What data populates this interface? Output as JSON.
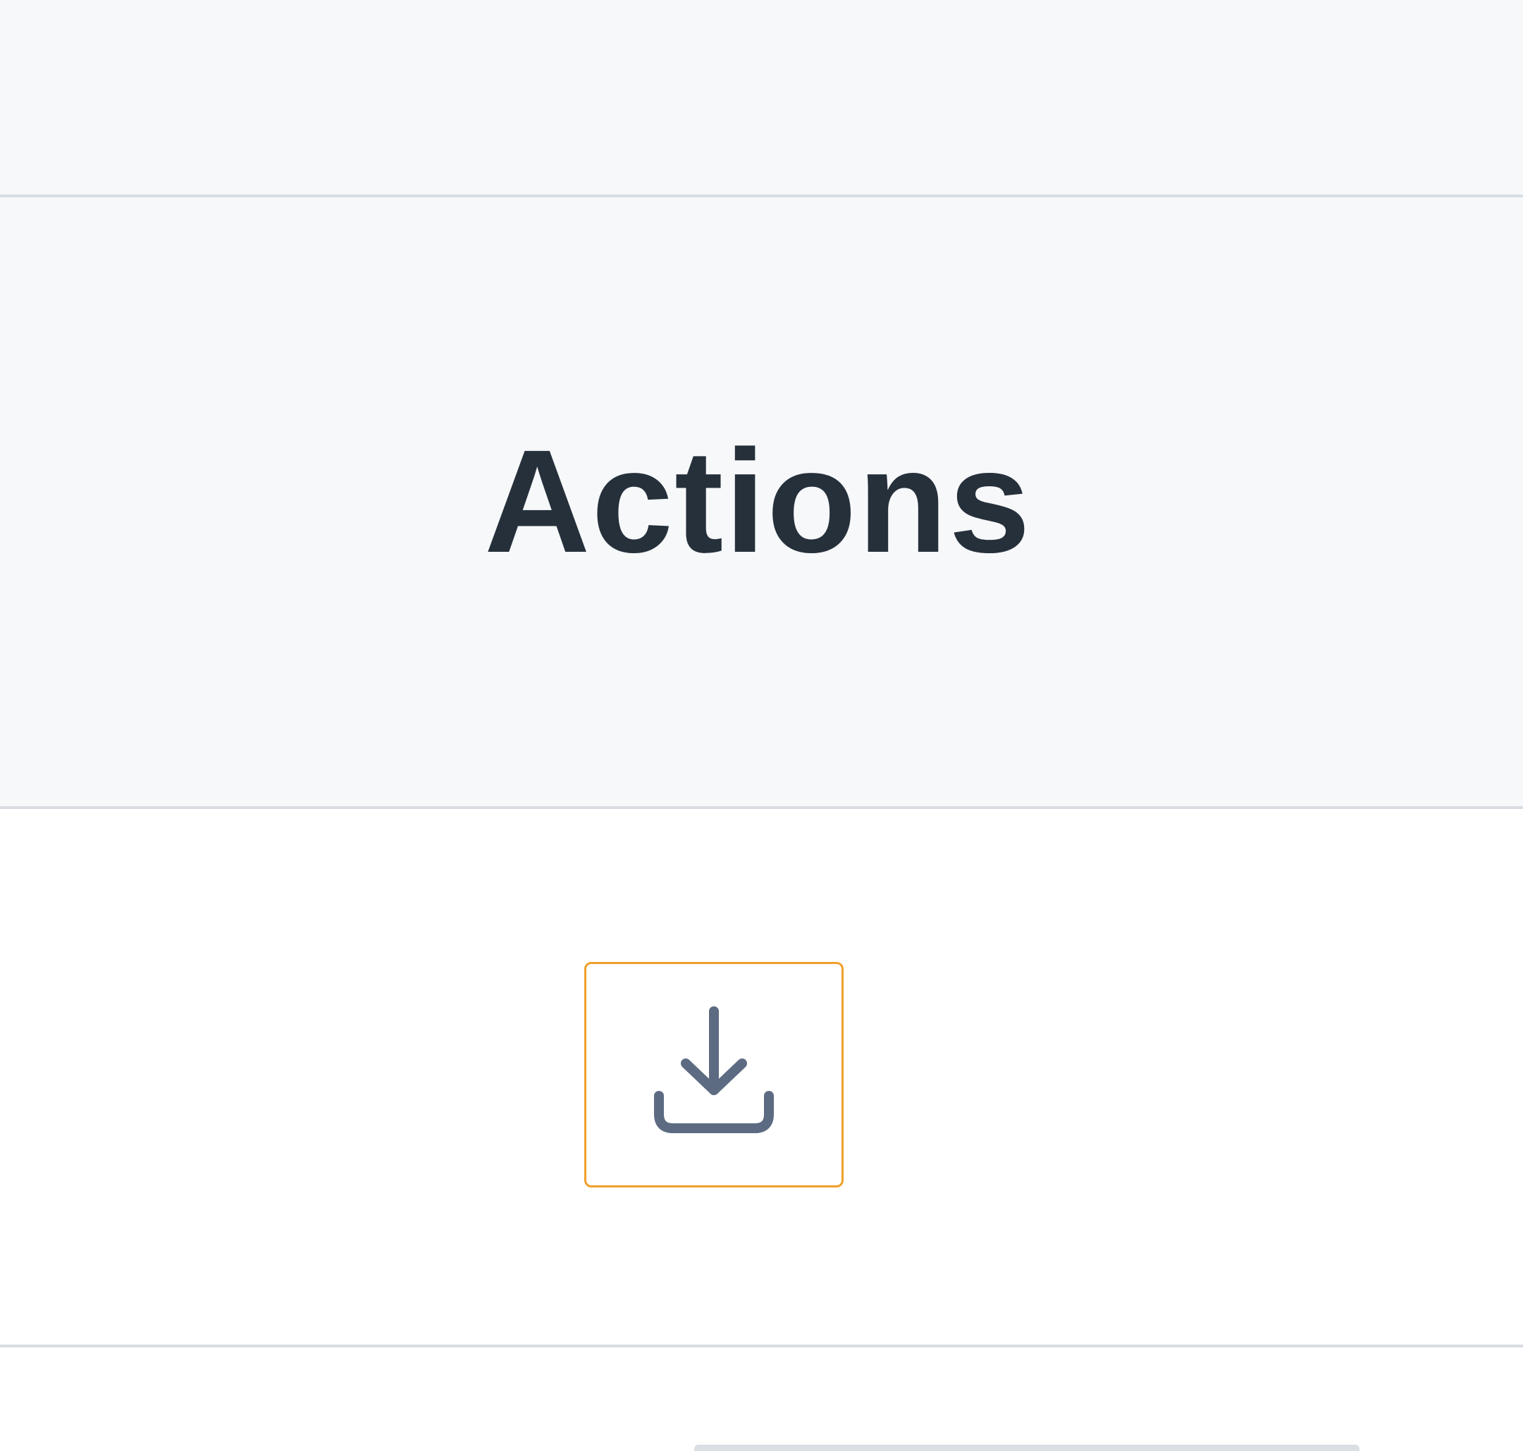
{
  "table": {
    "header": {
      "actions_label": "Actions"
    },
    "row": {
      "download_icon": "download-icon"
    }
  },
  "colors": {
    "header_background": "#f6f8fa",
    "header_text": "#26303b",
    "divider": "#d8dde3",
    "focus_outline": "#f0a02a",
    "icon": "#5d6b82"
  }
}
